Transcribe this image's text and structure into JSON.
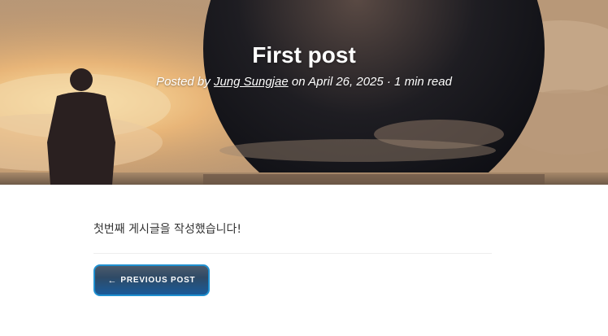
{
  "hero": {
    "title": "First post",
    "meta": {
      "prefix": "Posted by ",
      "author": "Jung Sungjae",
      "date_text": " on April 26, 2025 · 1 min read"
    }
  },
  "post": {
    "body": "첫번째 게시글을 작성했습니다!"
  },
  "pager": {
    "previous_arrow": "←",
    "previous_label": "PREVIOUS POST"
  }
}
